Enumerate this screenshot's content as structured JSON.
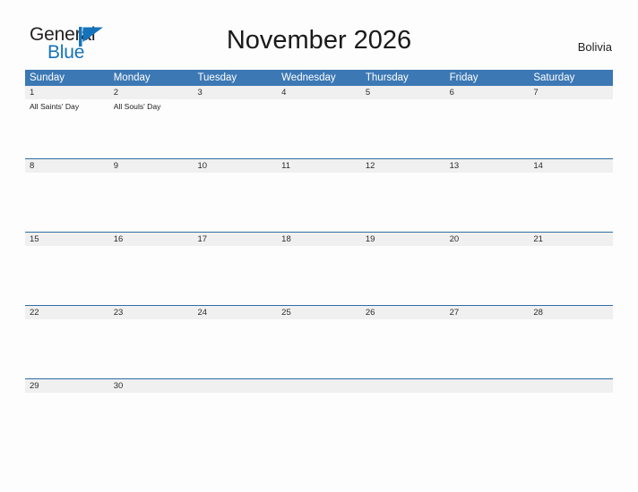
{
  "brand": {
    "name_line1": "General",
    "name_line2": "Blue",
    "flag_color": "#1573bb"
  },
  "header": {
    "title": "November 2026",
    "region": "Bolivia"
  },
  "calendar": {
    "accent_color": "#3c78b4",
    "weekday_headers": [
      "Sunday",
      "Monday",
      "Tuesday",
      "Wednesday",
      "Thursday",
      "Friday",
      "Saturday"
    ],
    "weeks": [
      {
        "days": [
          {
            "num": "1",
            "events": [
              "All Saints' Day"
            ]
          },
          {
            "num": "2",
            "events": [
              "All Souls' Day"
            ]
          },
          {
            "num": "3",
            "events": []
          },
          {
            "num": "4",
            "events": []
          },
          {
            "num": "5",
            "events": []
          },
          {
            "num": "6",
            "events": []
          },
          {
            "num": "7",
            "events": []
          }
        ]
      },
      {
        "days": [
          {
            "num": "8",
            "events": []
          },
          {
            "num": "9",
            "events": []
          },
          {
            "num": "10",
            "events": []
          },
          {
            "num": "11",
            "events": []
          },
          {
            "num": "12",
            "events": []
          },
          {
            "num": "13",
            "events": []
          },
          {
            "num": "14",
            "events": []
          }
        ]
      },
      {
        "days": [
          {
            "num": "15",
            "events": []
          },
          {
            "num": "16",
            "events": []
          },
          {
            "num": "17",
            "events": []
          },
          {
            "num": "18",
            "events": []
          },
          {
            "num": "19",
            "events": []
          },
          {
            "num": "20",
            "events": []
          },
          {
            "num": "21",
            "events": []
          }
        ]
      },
      {
        "days": [
          {
            "num": "22",
            "events": []
          },
          {
            "num": "23",
            "events": []
          },
          {
            "num": "24",
            "events": []
          },
          {
            "num": "25",
            "events": []
          },
          {
            "num": "26",
            "events": []
          },
          {
            "num": "27",
            "events": []
          },
          {
            "num": "28",
            "events": []
          }
        ]
      },
      {
        "days": [
          {
            "num": "29",
            "events": []
          },
          {
            "num": "30",
            "events": []
          },
          {
            "num": "",
            "events": []
          },
          {
            "num": "",
            "events": []
          },
          {
            "num": "",
            "events": []
          },
          {
            "num": "",
            "events": []
          },
          {
            "num": "",
            "events": []
          }
        ]
      }
    ]
  }
}
